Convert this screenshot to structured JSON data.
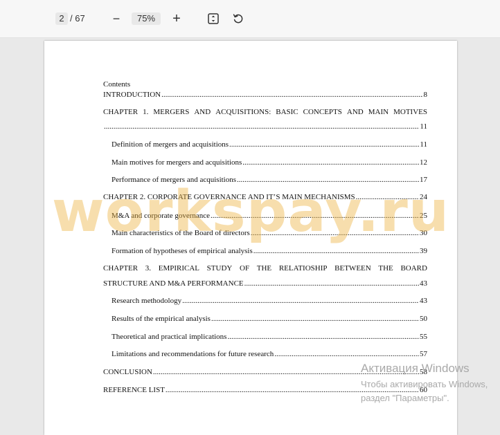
{
  "toolbar": {
    "current_page": "2",
    "total_pages": "/ 67",
    "zoom_out_label": "−",
    "zoom_level": "75%",
    "zoom_in_label": "+",
    "fit_icon": "fit-page-icon",
    "rotate_icon": "rotate-icon"
  },
  "document": {
    "contents_heading": "Contents",
    "toc": [
      {
        "label": "INTRODUCTION",
        "page": "8"
      },
      {
        "label_line1_words": [
          "CHAPTER",
          "1.",
          "MERGERS",
          "AND",
          "ACQUISITIONS:",
          "BASIC",
          "CONCEPTS",
          "AND",
          "MAIN",
          "MOTIVES"
        ],
        "label": "",
        "page": "11"
      },
      {
        "label": "Definition of mergers and acquisitions",
        "page": "11"
      },
      {
        "label": "Main motives for mergers and acquisitions",
        "page": "12"
      },
      {
        "label": "Performance of mergers and acquisitions",
        "page": "17"
      },
      {
        "label": "CHAPTER 2. CORPORATE GOVERNANCE AND IT’S MAIN MECHANISMS",
        "page": "24"
      },
      {
        "label": "M&A and corporate governance",
        "page": "25"
      },
      {
        "label": "Main characteristics of the Board of directors",
        "page": "30"
      },
      {
        "label": "Formation of hypotheses of empirical analysis",
        "page": "39"
      },
      {
        "label_line1_words": [
          "CHAPTER",
          "3.",
          "EMPIRICAL",
          "STUDY",
          "OF",
          "THE",
          "RELATIOSHIP",
          "BETWEEN",
          "THE",
          "BOARD"
        ],
        "label": "STRUCTURE AND M&A PERFORMANCE",
        "page": "43"
      },
      {
        "label": "Research methodology",
        "page": "43"
      },
      {
        "label": "Results of the empirical analysis",
        "page": "50"
      },
      {
        "label": "Theoretical and practical implications",
        "page": "55"
      },
      {
        "label": "Limitations and recommendations for future research",
        "page": "57"
      },
      {
        "label": "CONCLUSION",
        "page": "58"
      },
      {
        "label": "REFERENCE LIST",
        "page": "60"
      }
    ]
  },
  "watermark": {
    "text": "workspay.ru",
    "color": "#ebb03c"
  },
  "activation": {
    "title": "Активация Windows",
    "line1": "Чтобы активировать Windows,",
    "line2": "раздел \"Параметры\"."
  }
}
